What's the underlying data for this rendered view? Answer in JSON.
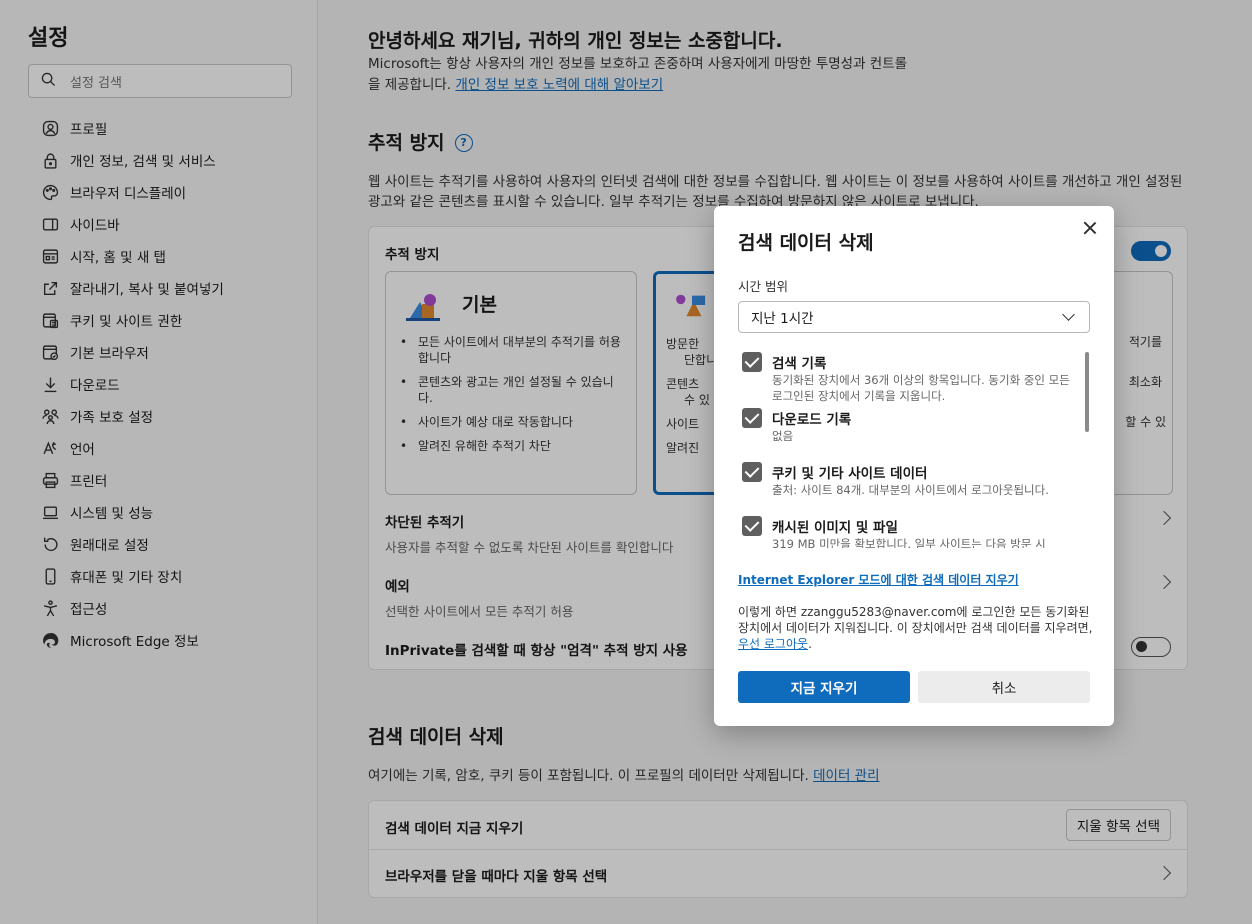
{
  "sidebar": {
    "title": "설정",
    "search_placeholder": "설정 검색",
    "items": [
      {
        "label": "프로필",
        "icon": "profile-icon"
      },
      {
        "label": "개인 정보, 검색 및 서비스",
        "icon": "lock-icon"
      },
      {
        "label": "브라우저 디스플레이",
        "icon": "palette-icon"
      },
      {
        "label": "사이드바",
        "icon": "sidebar-icon"
      },
      {
        "label": "시작, 홈 및 새 탭",
        "icon": "home-tab-icon"
      },
      {
        "label": "잘라내기, 복사 및 붙여넣기",
        "icon": "share-icon"
      },
      {
        "label": "쿠키 및 사이트 권한",
        "icon": "cookie-permissions-icon"
      },
      {
        "label": "기본 브라우저",
        "icon": "browser-icon"
      },
      {
        "label": "다운로드",
        "icon": "download-icon"
      },
      {
        "label": "가족 보호 설정",
        "icon": "family-icon"
      },
      {
        "label": "언어",
        "icon": "language-icon"
      },
      {
        "label": "프린터",
        "icon": "printer-icon"
      },
      {
        "label": "시스템 및 성능",
        "icon": "system-icon"
      },
      {
        "label": "원래대로 설정",
        "icon": "reset-icon"
      },
      {
        "label": "휴대폰 및 기타 장치",
        "icon": "phone-icon"
      },
      {
        "label": "접근성",
        "icon": "accessibility-icon"
      },
      {
        "label": "Microsoft Edge 정보",
        "icon": "edge-icon"
      }
    ]
  },
  "main": {
    "greeting": "안녕하세요 재기님, 귀하의 개인 정보는 소중합니다.",
    "greeting_desc": "Microsoft는 항상 사용자의 개인 정보를 보호하고 존중하며 사용자에게 마땅한 투명성과 컨트롤을 제공합니다. ",
    "greeting_link": "개인 정보 보호 노력에 대해 알아보기",
    "tracking_title": "추적 방지",
    "tracking_desc": "웹 사이트는 추적기를 사용하여 사용자의 인터넷 검색에 대한 정보를 수집합니다. 웹 사이트는 이 정보를 사용하여 사이트를 개선하고 개인 설정된 광고와 같은 콘텐츠를 표시할 수 있습니다. 일부 추적기는 정보를 수집하여 방문하지 않은 사이트로 보냅니다.",
    "tracking_card_label": "추적 방지",
    "basic": {
      "name": "기본",
      "bullets": [
        "모든 사이트에서 대부분의 추적기를 허용합니다",
        "콘텐츠와 광고는 개인 설정될 수 있습니다.",
        "사이트가 예상 대로 작동합니다",
        "알려진 유해한 추적기 차단"
      ]
    },
    "balanced_clipped": [
      "방문한",
      "단합니",
      "콘텐츠",
      "수 있",
      "사이트",
      "알려진"
    ],
    "strict_clipped": [
      "적기를",
      "최소화",
      "할 수 있"
    ],
    "blocked_title": "차단된 추적기",
    "blocked_sub": "사용자를 추적할 수 없도록 차단된 사이트를 확인합니다",
    "exceptions_title": "예외",
    "exceptions_sub": "선택한 사이트에서 모든 추적기 허용",
    "inprivate_label": "InPrivate를 검색할 때 항상 \"엄격\" 추적 방지 사용",
    "clear_title": "검색 데이터 삭제",
    "clear_desc": "여기에는 기록, 암호, 쿠키 등이 포함됩니다. 이 프로필의 데이터만 삭제됩니다. ",
    "clear_link": "데이터 관리",
    "clear_now_label": "검색 데이터 지금 지우기",
    "choose_button": "지울 항목 선택",
    "on_close_label": "브라우저를 닫을 때마다 지울 항목 선택"
  },
  "dialog": {
    "title": "검색 데이터 삭제",
    "range_label": "시간 범위",
    "range_value": "지난 1시간",
    "options": [
      {
        "title": "검색 기록",
        "desc": "동기화된 장치에서 36개 이상의 항목입니다. 동기화 중인 모든 로그인된 장치에서 기록을 지웁니다.",
        "checked": true
      },
      {
        "title": "다운로드 기록",
        "desc": "없음",
        "checked": true
      },
      {
        "title": "쿠키 및 기타 사이트 데이터",
        "desc": "출처: 사이트 84개. 대부분의 사이트에서 로그아웃됩니다.",
        "checked": true
      },
      {
        "title": "캐시된 이미지 및 파일",
        "desc": "319 MB 미만을 확보합니다. 일부 사이트는 다음 방문 시",
        "checked": true
      }
    ],
    "ie_link": "Internet Explorer 모드에 대한 검색 데이터 지우기",
    "note_before": "이렇게 하면 zzanggu5283@naver.com에 로그인한 모든 동기화된 장치에서 데이터가 지워집니다. 이 장치에서만 검색 데이터를 지우려면, ",
    "note_link": "우선 로그아웃",
    "note_after": ".",
    "clear_button": "지금 지우기",
    "cancel_button": "취소"
  },
  "colors": {
    "accent": "#0f6cbd",
    "checkbox": "#5f5f5f",
    "overlay": "rgba(0,0,0,0.26)"
  }
}
